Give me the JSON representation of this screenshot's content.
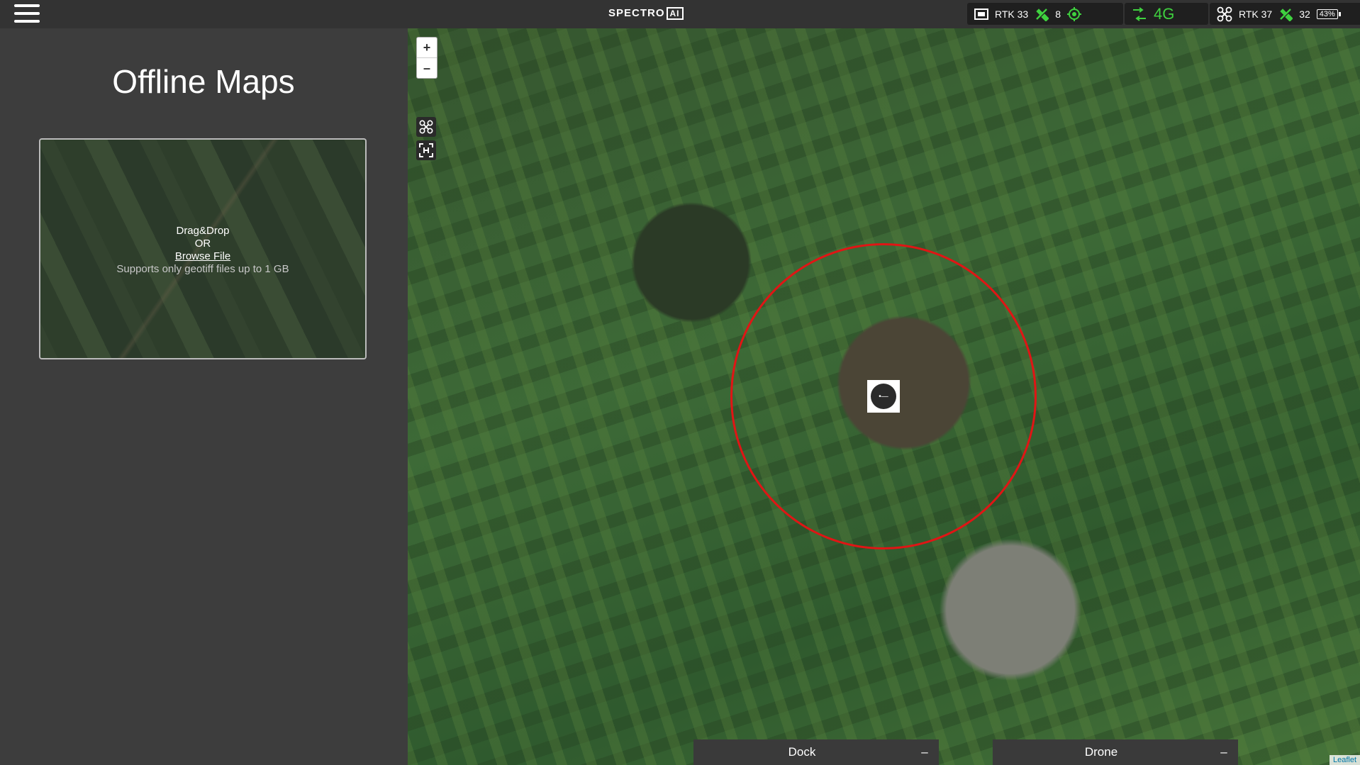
{
  "brand": {
    "name": "SPECTRO",
    "badge": "AI"
  },
  "status": {
    "dock_rtk": "RTK 33",
    "dock_sats": "8",
    "network": "4G",
    "drone_rtk": "RTK 37",
    "drone_sats": "32",
    "battery": "43%"
  },
  "panel": {
    "title": "Offline Maps",
    "drop": {
      "line1": "Drag&Drop",
      "line2": "OR",
      "browse": "Browse File",
      "hint": "Supports only geotiff files up to 1 GB"
    }
  },
  "map": {
    "zoom_in": "+",
    "zoom_out": "–",
    "tabs": {
      "dock": "Dock",
      "drone": "Drone",
      "minimize": "–"
    },
    "attribution": "Leaflet"
  },
  "colors": {
    "geofence": "#e01515",
    "status_ok": "#3fd13f",
    "panel_bg": "#3d3d3d"
  }
}
